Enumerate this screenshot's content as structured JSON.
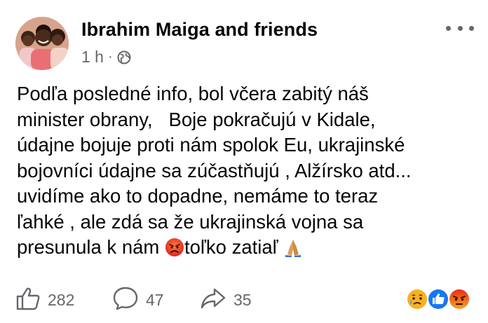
{
  "post": {
    "author": "Ibrahim Maiga and friends",
    "time": "1 h",
    "separator": "·",
    "privacy_icon": "globe-icon",
    "more_icon": "more-options-icon",
    "text_lines": [
      "Podľa posledné info, bol včera zabitý náš",
      "minister obrany,   Boje pokračujú v Kidale,",
      "údajne bojuje proti nám spolok Eu, ukrajinské",
      "bojovníci údajne sa zúčastňujú , Alžírsko atd...",
      "uvidíme ako to dopadne, nemáme to teraz",
      "ľahké , ale zdá sa že ukrajinská vojna sa"
    ],
    "last_line": {
      "before": "presunula k nám ",
      "emoji_1": "angry-face-emoji",
      "middle": "toľko zatiaľ ",
      "emoji_2": "folded-hands-emoji"
    }
  },
  "footer": {
    "like_icon": "thumbs-up-icon",
    "like_count": "282",
    "comment_icon": "comment-bubble-icon",
    "comment_count": "47",
    "share_icon": "share-arrow-icon",
    "share_count": "35",
    "reactions": [
      "sad-reaction",
      "like-reaction",
      "angry-reaction"
    ]
  },
  "colors": {
    "text": "#050505",
    "secondary": "#65676b",
    "like_blue": "#1877f2",
    "sad_yellow": "#f7b125",
    "angry_red": "#e9710f"
  }
}
